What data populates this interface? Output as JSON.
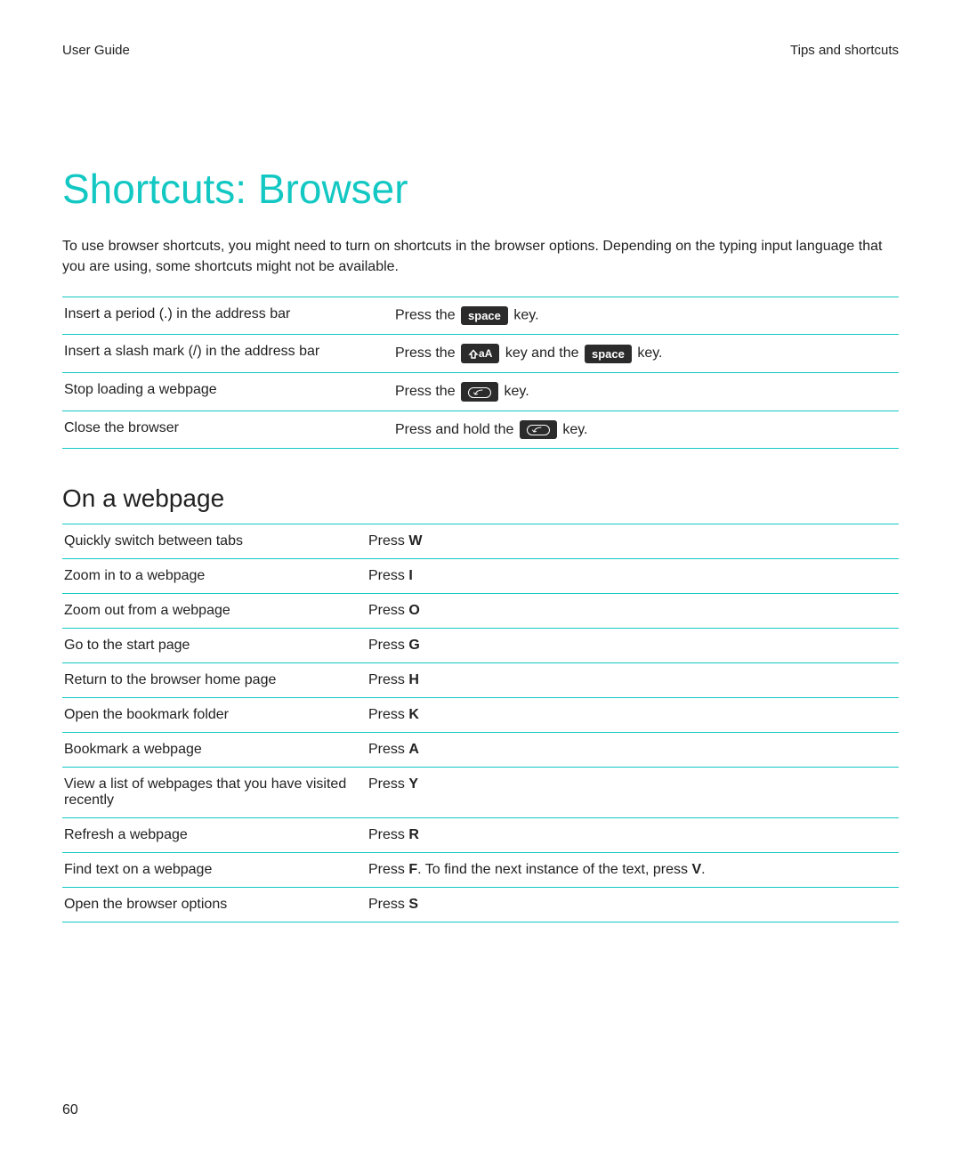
{
  "header": {
    "left": "User Guide",
    "right": "Tips and shortcuts"
  },
  "title": "Shortcuts: Browser",
  "intro": "To use browser shortcuts, you might need to turn on shortcuts in the browser options. Depending on the typing input language that you are using, some shortcuts might not be available.",
  "table1": {
    "rows": [
      {
        "action": "Insert a period (.) in the address bar",
        "prefix": "Press the ",
        "key1_type": "text",
        "key1_label": "space",
        "mid": "",
        "key2_type": "",
        "key2_label": "",
        "suffix": " key."
      },
      {
        "action": "Insert a slash mark (/) in the address bar",
        "prefix": "Press the ",
        "key1_type": "shift",
        "key1_label": "aA",
        "mid": " key and the ",
        "key2_type": "text",
        "key2_label": "space",
        "suffix": " key."
      },
      {
        "action": "Stop loading a webpage",
        "prefix": "Press the ",
        "key1_type": "back",
        "key1_label": "",
        "mid": "",
        "key2_type": "",
        "key2_label": "",
        "suffix": " key."
      },
      {
        "action": "Close the browser",
        "prefix": "Press and hold the ",
        "key1_type": "back",
        "key1_label": "",
        "mid": "",
        "key2_type": "",
        "key2_label": "",
        "suffix": " key."
      }
    ]
  },
  "section2": {
    "heading": "On a webpage",
    "rows": [
      {
        "action": "Quickly switch between tabs",
        "prefix": "Press ",
        "bold1": "W",
        "mid": "",
        "bold2": "",
        "suffix": ""
      },
      {
        "action": "Zoom in to a webpage",
        "prefix": "Press ",
        "bold1": "I",
        "mid": "",
        "bold2": "",
        "suffix": ""
      },
      {
        "action": "Zoom out from a webpage",
        "prefix": "Press ",
        "bold1": "O",
        "mid": "",
        "bold2": "",
        "suffix": ""
      },
      {
        "action": "Go to the start page",
        "prefix": "Press ",
        "bold1": "G",
        "mid": "",
        "bold2": "",
        "suffix": ""
      },
      {
        "action": "Return to the browser home page",
        "prefix": "Press ",
        "bold1": "H",
        "mid": "",
        "bold2": "",
        "suffix": ""
      },
      {
        "action": "Open the bookmark folder",
        "prefix": "Press ",
        "bold1": "K",
        "mid": "",
        "bold2": "",
        "suffix": ""
      },
      {
        "action": "Bookmark a webpage",
        "prefix": "Press ",
        "bold1": "A",
        "mid": "",
        "bold2": "",
        "suffix": ""
      },
      {
        "action": "View a list of webpages that you have visited recently",
        "prefix": "Press ",
        "bold1": "Y",
        "mid": "",
        "bold2": "",
        "suffix": ""
      },
      {
        "action": "Refresh a webpage",
        "prefix": "Press ",
        "bold1": "R",
        "mid": "",
        "bold2": "",
        "suffix": ""
      },
      {
        "action": "Find text on a webpage",
        "prefix": "Press ",
        "bold1": "F",
        "mid": ". To find the next instance of the text, press ",
        "bold2": "V",
        "suffix": "."
      },
      {
        "action": "Open the browser options",
        "prefix": "Press ",
        "bold1": "S",
        "mid": "",
        "bold2": "",
        "suffix": ""
      }
    ]
  },
  "page_number": "60"
}
